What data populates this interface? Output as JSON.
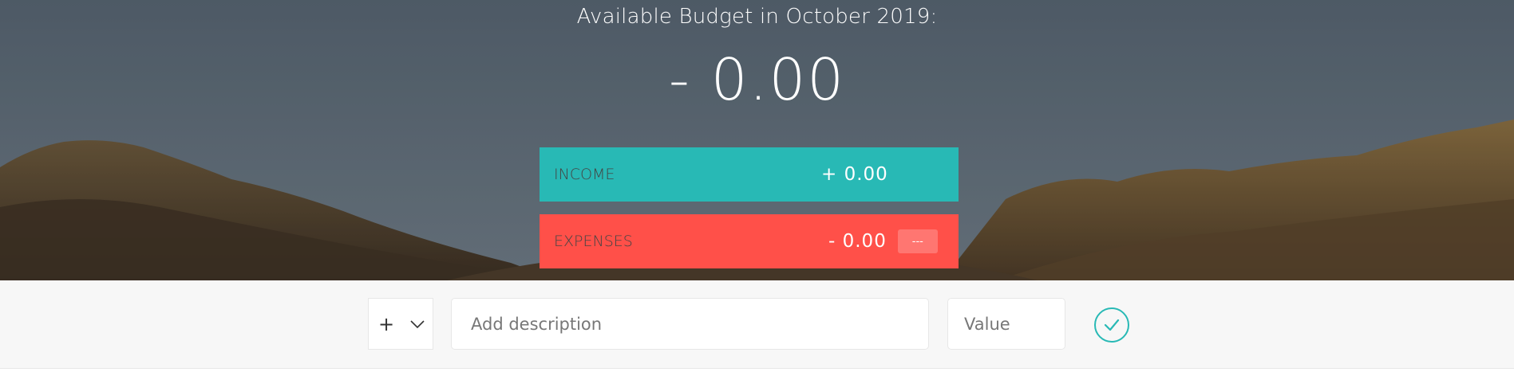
{
  "budget": {
    "title": "Available Budget in October 2019:",
    "value": "- 0.00"
  },
  "income": {
    "label": "Income",
    "value": "+ 0.00"
  },
  "expenses": {
    "label": "Expenses",
    "value": "- 0.00",
    "percentage": "---"
  },
  "add": {
    "type_selected": "+",
    "description_placeholder": "Add description",
    "value_placeholder": "Value"
  },
  "colors": {
    "income": "#28b9b5",
    "expenses": "#ff5049",
    "accent": "#28b9b5"
  }
}
